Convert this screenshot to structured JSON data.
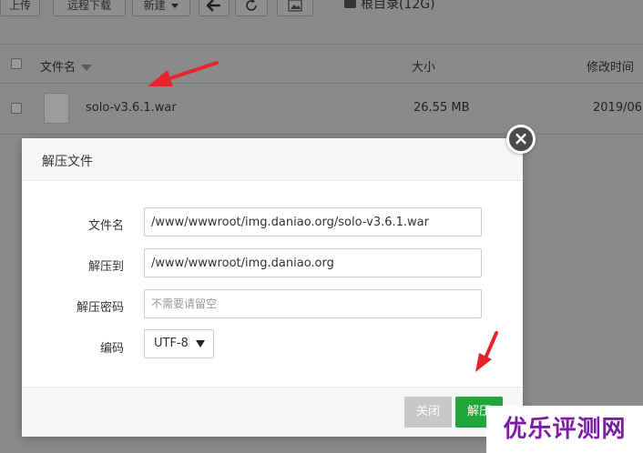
{
  "toolbar": {
    "upload": "上传",
    "remote_download": "远程下载",
    "new": "新建",
    "path": "根目录(12G)"
  },
  "table": {
    "headers": {
      "name": "文件名",
      "size": "大小",
      "modified": "修改时间"
    },
    "rows": [
      {
        "name": "solo-v3.6.1.war",
        "size": "26.55 MB",
        "modified": "2019/06,"
      }
    ]
  },
  "modal": {
    "title": "解压文件",
    "fields": {
      "filename_label": "文件名",
      "filename_value": "/www/wwwroot/img.daniao.org/solo-v3.6.1.war",
      "target_label": "解压到",
      "target_value": "/www/wwwroot/img.daniao.org",
      "password_label": "解压密码",
      "password_placeholder": "不需要请留空",
      "encoding_label": "编码",
      "encoding_value": "UTF-8"
    },
    "buttons": {
      "close": "关闭",
      "unzip": "解压"
    }
  },
  "watermark": "优乐评测网",
  "colors": {
    "primary_green": "#20a53a",
    "disabled_gray": "#c7c7c7",
    "arrow_red": "#e8232b",
    "watermark_purple": "#7a1fa2"
  }
}
